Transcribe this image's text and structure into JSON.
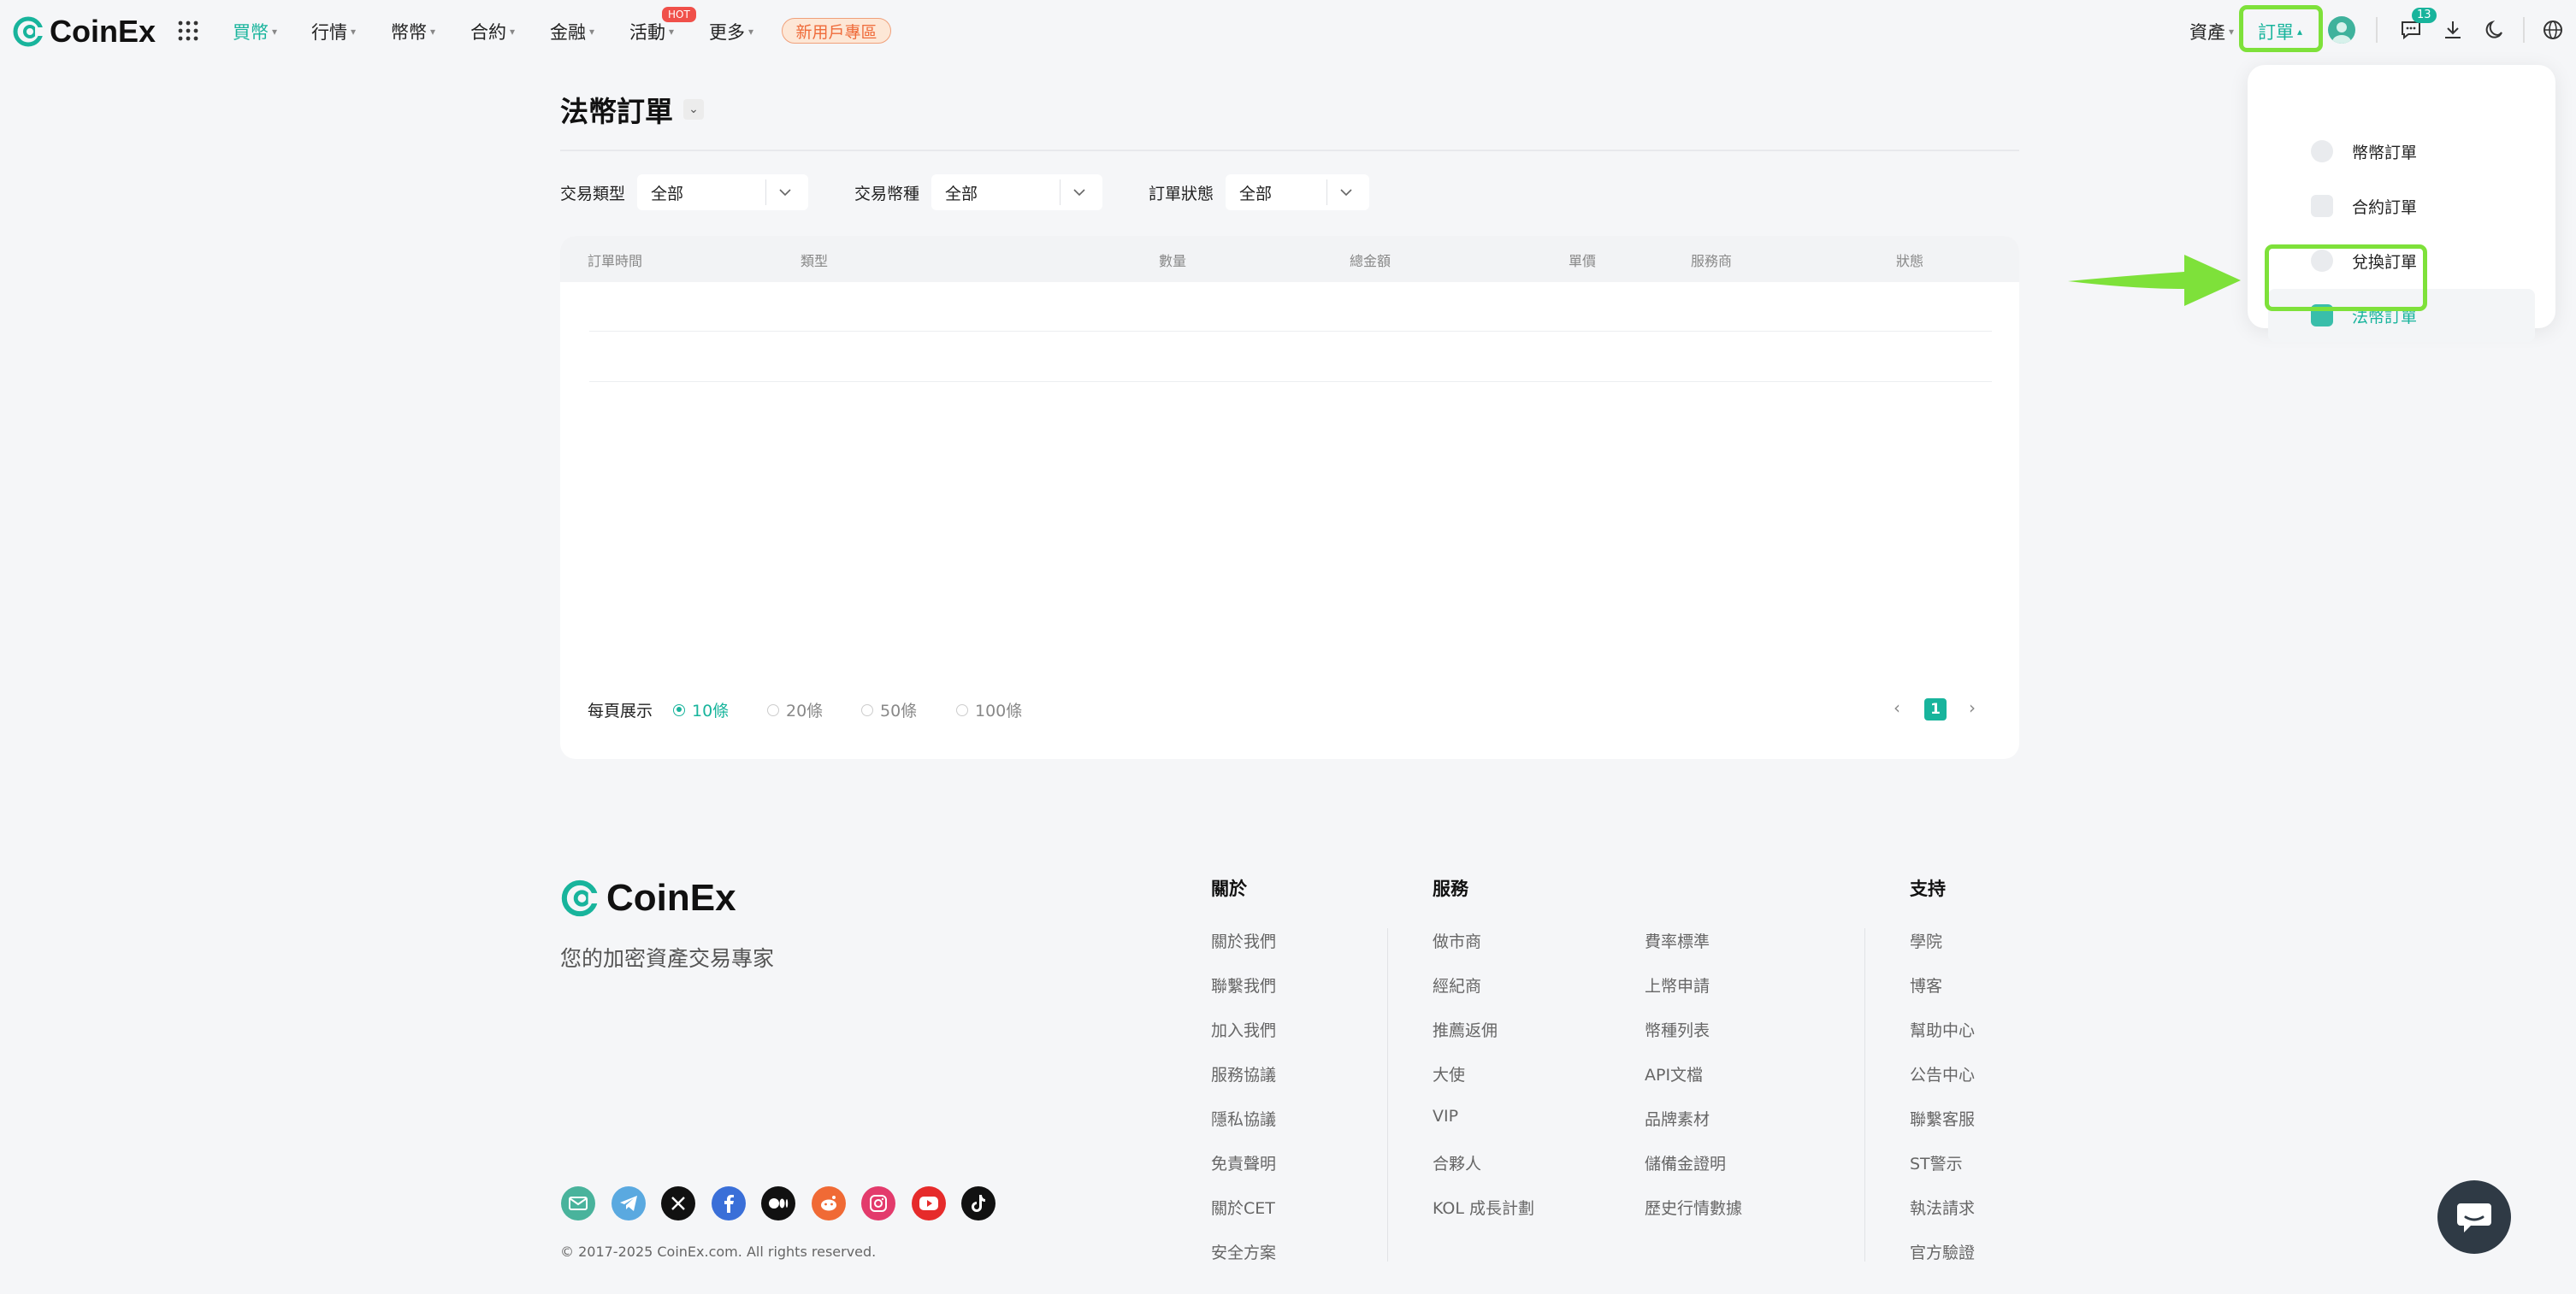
{
  "header": {
    "brand": "CoinEx",
    "nav": [
      {
        "label": "買幣",
        "active": true
      },
      {
        "label": "行情"
      },
      {
        "label": "幣幣"
      },
      {
        "label": "合約"
      },
      {
        "label": "金融"
      },
      {
        "label": "活動"
      },
      {
        "label": "更多"
      }
    ],
    "hot_badge": "HOT",
    "promo_label": "新用戶專區",
    "assets_label": "資產",
    "orders_label": "訂單",
    "message_count": "13"
  },
  "orders_menu": {
    "items": [
      {
        "label": "幣幣訂單",
        "icon": "coin-icon"
      },
      {
        "label": "合約訂單",
        "icon": "document-icon"
      },
      {
        "label": "兌換訂單",
        "icon": "exchange-icon"
      },
      {
        "label": "法幣訂單",
        "icon": "wallet-icon",
        "active": true
      }
    ]
  },
  "main": {
    "title": "法幣訂單",
    "filters": {
      "trade_type": {
        "label": "交易類型",
        "value": "全部"
      },
      "trade_coin": {
        "label": "交易幣種",
        "value": "全部"
      },
      "order_status": {
        "label": "訂單狀態",
        "value": "全部"
      }
    },
    "table": {
      "columns": [
        "訂單時間",
        "類型",
        "數量",
        "總金額",
        "單價",
        "服務商",
        "狀態"
      ],
      "rows": []
    },
    "pagination": {
      "per_page_label": "每頁展示",
      "options": [
        "10條",
        "20條",
        "50條",
        "100條"
      ],
      "selected": "10條",
      "current_page": "1"
    }
  },
  "footer": {
    "brand": "CoinEx",
    "tagline": "您的加密資產交易專家",
    "columns": {
      "about": {
        "title": "關於",
        "links": [
          "關於我們",
          "聯繫我們",
          "加入我們",
          "服務協議",
          "隱私協議",
          "免責聲明",
          "關於CET",
          "安全方案"
        ]
      },
      "services": {
        "title": "服務",
        "links_a": [
          "做市商",
          "經紀商",
          "推薦返佣",
          "大使",
          "VIP",
          "合夥人",
          "KOL 成長計劃"
        ],
        "links_b": [
          "費率標準",
          "上幣申請",
          "幣種列表",
          "API文檔",
          "品牌素材",
          "儲備金證明",
          "歷史行情數據"
        ]
      },
      "support": {
        "title": "支持",
        "links": [
          "學院",
          "博客",
          "幫助中心",
          "公告中心",
          "聯繫客服",
          "ST警示",
          "執法請求",
          "官方驗證"
        ]
      }
    },
    "socials": [
      {
        "name": "email-icon",
        "color": "#49b39c"
      },
      {
        "name": "telegram-icon",
        "color": "#5aa9e0"
      },
      {
        "name": "x-icon",
        "color": "#111111"
      },
      {
        "name": "facebook-icon",
        "color": "#3a6fd8"
      },
      {
        "name": "medium-icon",
        "color": "#111111"
      },
      {
        "name": "reddit-icon",
        "color": "#f06a35"
      },
      {
        "name": "instagram-icon",
        "color": "#e33b6c"
      },
      {
        "name": "youtube-icon",
        "color": "#e62b2b"
      },
      {
        "name": "tiktok-icon",
        "color": "#111111"
      }
    ],
    "copyright": "© 2017-2025 CoinEx.com. All rights reserved."
  },
  "colors": {
    "accent": "#18b49c",
    "highlight": "#7ee13a"
  }
}
